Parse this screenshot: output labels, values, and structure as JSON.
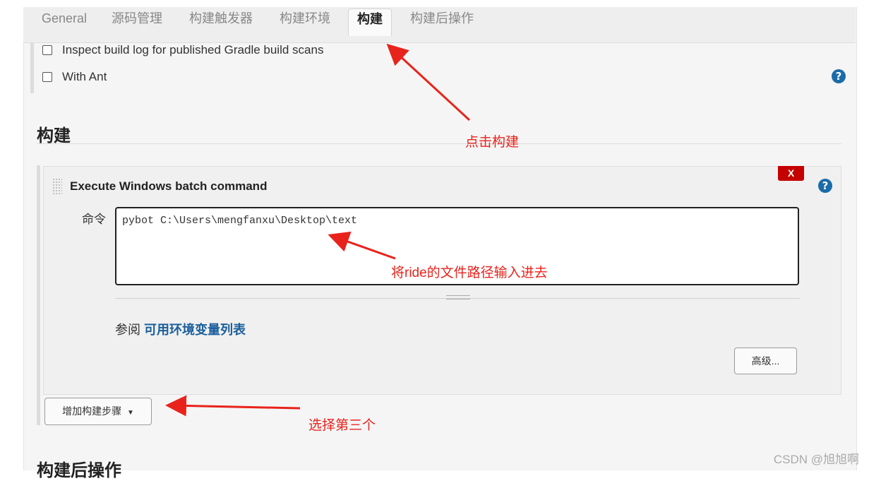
{
  "tabs": [
    {
      "label": "General"
    },
    {
      "label": "源码管理"
    },
    {
      "label": "构建触发器"
    },
    {
      "label": "构建环境"
    },
    {
      "label": "构建"
    },
    {
      "label": "构建后操作"
    }
  ],
  "options": {
    "gradle_scans": "Inspect build log for published Gradle build scans",
    "with_ant": "With Ant"
  },
  "build_section": {
    "heading": "构建",
    "step_title": "Execute Windows batch command",
    "command_label": "命令",
    "command_value": "pybot C:\\Users\\mengfanxu\\Desktop\\text",
    "see_prefix": "参阅",
    "see_link": "可用环境变量列表",
    "advanced_button": "高级...",
    "delete_button": "X",
    "add_step_button": "增加构建步骤"
  },
  "post_build_heading": "构建后操作",
  "annotations": {
    "click_build": "点击构建",
    "enter_path": "将ride的文件路径输入进去",
    "choose_third": "选择第三个"
  },
  "watermark": "CSDN @旭旭啊",
  "colors": {
    "annotation": "#e8231c",
    "help_icon": "#1b6ba8",
    "delete": "#c40000",
    "link": "#1b5f9c"
  }
}
